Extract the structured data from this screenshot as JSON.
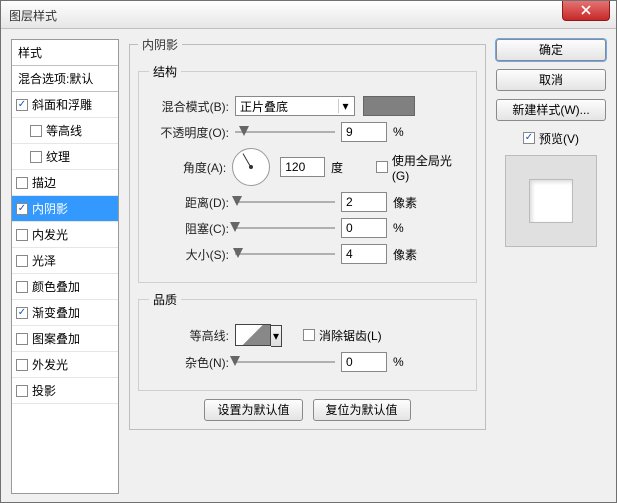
{
  "window": {
    "title": "图层样式"
  },
  "buttons": {
    "ok": "确定",
    "cancel": "取消",
    "newstyle": "新建样式(W)...",
    "preview": "预览(V)"
  },
  "left": {
    "header": "样式",
    "sub": "混合选项:默认",
    "items": [
      {
        "label": "斜面和浮雕",
        "checked": true,
        "indent": false
      },
      {
        "label": "等高线",
        "checked": false,
        "indent": true
      },
      {
        "label": "纹理",
        "checked": false,
        "indent": true
      },
      {
        "label": "描边",
        "checked": false,
        "indent": false
      },
      {
        "label": "内阴影",
        "checked": true,
        "indent": false,
        "selected": true
      },
      {
        "label": "内发光",
        "checked": false,
        "indent": false
      },
      {
        "label": "光泽",
        "checked": false,
        "indent": false
      },
      {
        "label": "颜色叠加",
        "checked": false,
        "indent": false
      },
      {
        "label": "渐变叠加",
        "checked": true,
        "indent": false
      },
      {
        "label": "图案叠加",
        "checked": false,
        "indent": false
      },
      {
        "label": "外发光",
        "checked": false,
        "indent": false
      },
      {
        "label": "投影",
        "checked": false,
        "indent": false
      }
    ]
  },
  "panel": {
    "title": "内阴影",
    "struct_title": "结构",
    "quality_title": "品质",
    "blend_label": "混合模式(B):",
    "blend_value": "正片叠底",
    "color": "#808080",
    "opacity_label": "不透明度(O):",
    "opacity_value": "9",
    "opacity_unit": "%",
    "angle_label": "角度(A):",
    "angle_value": "120",
    "angle_unit": "度",
    "global_label": "使用全局光(G)",
    "global_checked": false,
    "distance_label": "距离(D):",
    "distance_value": "2",
    "distance_unit": "像素",
    "choke_label": "阻塞(C):",
    "choke_value": "0",
    "choke_unit": "%",
    "size_label": "大小(S):",
    "size_value": "4",
    "size_unit": "像素",
    "contour_label": "等高线:",
    "aa_label": "消除锯齿(L)",
    "aa_checked": false,
    "noise_label": "杂色(N):",
    "noise_value": "0",
    "noise_unit": "%",
    "make_default": "设置为默认值",
    "reset_default": "复位为默认值"
  }
}
